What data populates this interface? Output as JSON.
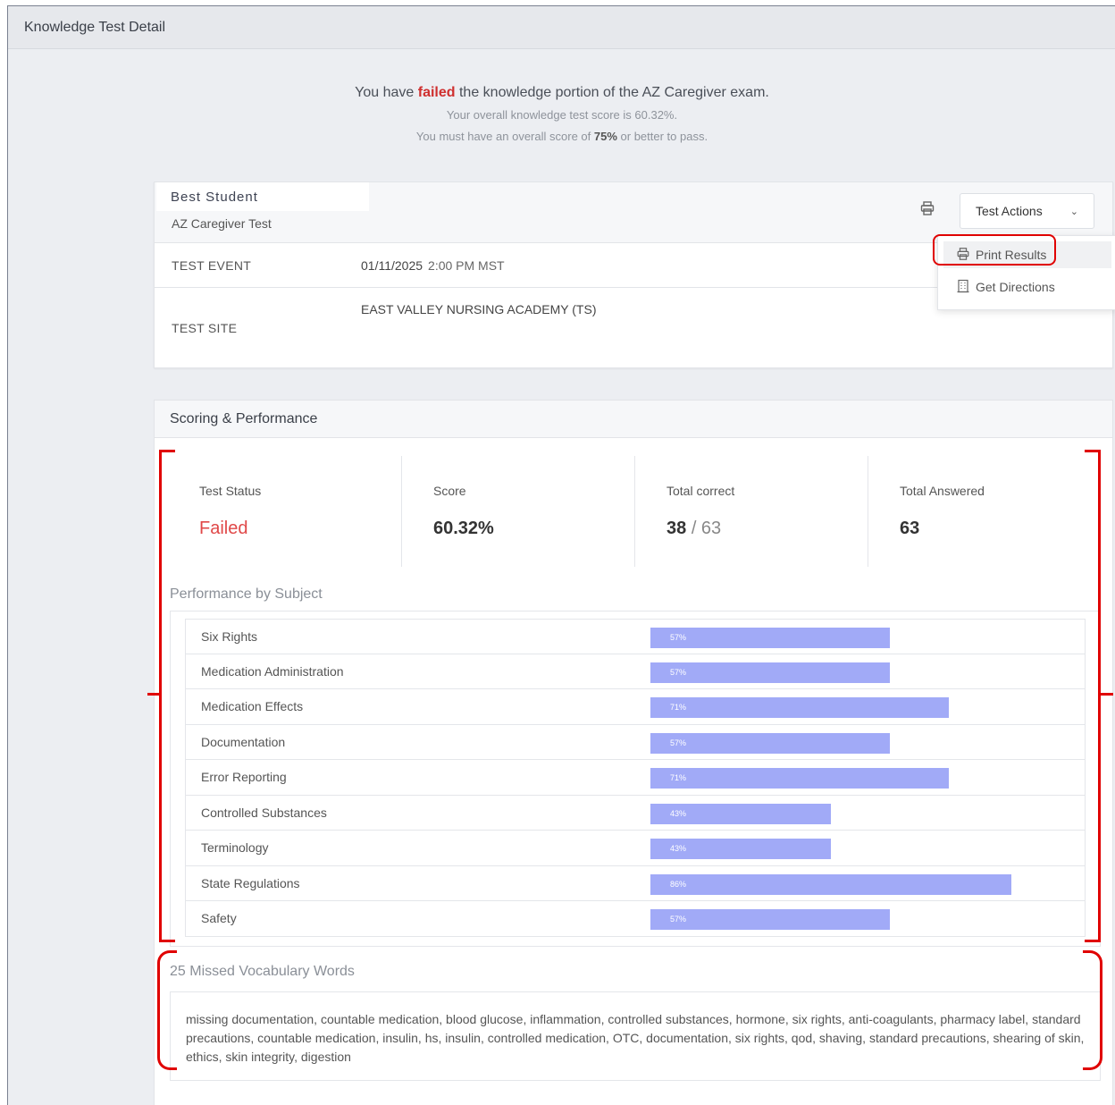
{
  "page_title": "Knowledge Test Detail",
  "banner": {
    "prefix": "You have",
    "status_word": "failed",
    "suffix": "the knowledge portion of the AZ Caregiver exam.",
    "score_line": "Your overall knowledge test score is 60.32%.",
    "req_prefix": "You must have an overall score of",
    "req_value": "75%",
    "req_suffix": "or better to pass."
  },
  "student": {
    "name": "Best Student",
    "test_name": "AZ Caregiver Test"
  },
  "actions": {
    "button_label": "Test Actions",
    "menu": [
      "Print Results",
      "Get Directions"
    ]
  },
  "event": {
    "label": "TEST EVENT",
    "date": "01/11/2025",
    "time": "2:00 PM MST"
  },
  "site": {
    "label": "TEST SITE",
    "value": "EAST VALLEY NURSING ACADEMY (TS)"
  },
  "scoring": {
    "title": "Scoring & Performance",
    "stats": [
      {
        "label": "Test Status",
        "value": "Failed"
      },
      {
        "label": "Score",
        "value": "60.32%"
      },
      {
        "label": "Total correct",
        "value": "38",
        "of": "/ 63"
      },
      {
        "label": "Total Answered",
        "value": "63"
      }
    ]
  },
  "performance": {
    "title": "Performance by Subject",
    "subjects": [
      {
        "name": "Six Rights",
        "pct": 57,
        "label": "57%"
      },
      {
        "name": "Medication Administration",
        "pct": 57,
        "label": "57%"
      },
      {
        "name": "Medication Effects",
        "pct": 71,
        "label": "71%"
      },
      {
        "name": "Documentation",
        "pct": 57,
        "label": "57%"
      },
      {
        "name": "Error Reporting",
        "pct": 71,
        "label": "71%"
      },
      {
        "name": "Controlled Substances",
        "pct": 43,
        "label": "43%"
      },
      {
        "name": "Terminology",
        "pct": 43,
        "label": "43%"
      },
      {
        "name": "State Regulations",
        "pct": 86,
        "label": "86%"
      },
      {
        "name": "Safety",
        "pct": 57,
        "label": "57%"
      }
    ]
  },
  "vocab": {
    "title": "25 Missed Vocabulary Words",
    "words": "missing documentation, countable medication, blood glucose, inflammation, controlled substances, hormone, six rights, anti-coagulants, pharmacy label, standard precautions, countable medication, insulin, hs, insulin, controlled medication, OTC, documentation, six rights, qod, shaving, standard precautions, shearing of skin, ethics, skin integrity, digestion"
  },
  "colors": {
    "failed": "#e04848",
    "bar": "#a1aaf7",
    "annotation": "#e00000"
  }
}
